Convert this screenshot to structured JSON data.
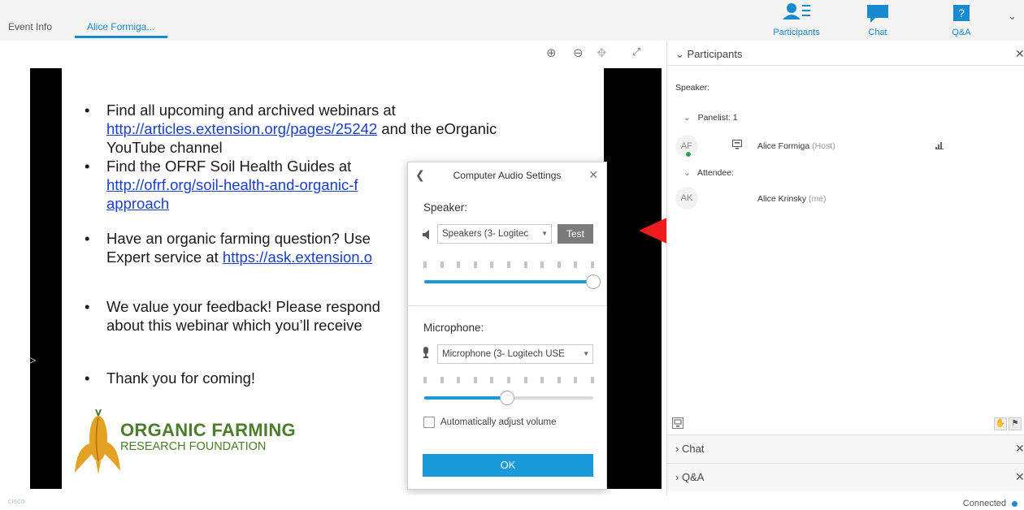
{
  "tabs": [
    "Event Info",
    "Alice Formiga..."
  ],
  "panels": [
    {
      "label": "Participants",
      "icon": "participants-icon"
    },
    {
      "label": "Chat",
      "icon": "chat-icon"
    },
    {
      "label": "Q&A",
      "icon": "qa-icon"
    }
  ],
  "slide": {
    "bullets": [
      {
        "lines": [
          {
            "text": "Find all upcoming and archived webinars at"
          },
          {
            "link": "http://articles.extension.org/pages/25242",
            "text": " and the eOrganic"
          },
          {
            "text": "YouTube channel"
          }
        ]
      },
      {
        "lines": [
          {
            "text": "Find the OFRF Soil Health Guides at"
          },
          {
            "link": "http://ofrf.org/soil-health-and-organic-f"
          },
          {
            "link": "approach"
          }
        ]
      },
      {
        "lines": [
          {
            "text": "Have an organic farming question? Use"
          },
          {
            "text": "Expert service at ",
            "link": "https://ask.extension.o"
          }
        ]
      },
      {
        "lines": [
          {
            "text": "We value your feedback! Please respond"
          },
          {
            "text": "about this webinar which you’ll receive"
          }
        ]
      },
      {
        "lines": [
          {
            "text": "Thank you for coming!"
          }
        ]
      }
    ],
    "logo_main": "ORGANIC FARMING",
    "logo_sub": "RESEARCH FOUNDATION"
  },
  "audio_dialog": {
    "title": "Computer Audio Settings",
    "speaker_label": "Speaker:",
    "speaker_device": "Speakers (3- Logitec",
    "test_label": "Test",
    "speaker_volume": 1.0,
    "microphone_label": "Microphone:",
    "microphone_device": "Microphone (3- Logitech USE",
    "microphone_volume": 0.49,
    "auto_adjust_label": "Automatically adjust volume",
    "auto_adjust_checked": false,
    "ok_label": "OK"
  },
  "participants": {
    "header": "Participants",
    "speaker_label": "Speaker:",
    "panelist_group": "Panelist: 1",
    "panelist": {
      "initials": "AF",
      "name": "Alice Formiga",
      "role": "(Host)"
    },
    "attendee_group": "Attendee:",
    "attendee": {
      "initials": "AK",
      "name": "Alice Krinsky",
      "role": "(me)"
    }
  },
  "collapsed_panels": [
    "Chat",
    "Q&A"
  ],
  "status": {
    "connection": "Connected",
    "cisco_logo": "cisco"
  },
  "colors": {
    "accent": "#1a8ad0",
    "dialog_button": "#1a9ad8",
    "arrow": "#ee1c1c",
    "logo_green": "#4c7d2b"
  }
}
